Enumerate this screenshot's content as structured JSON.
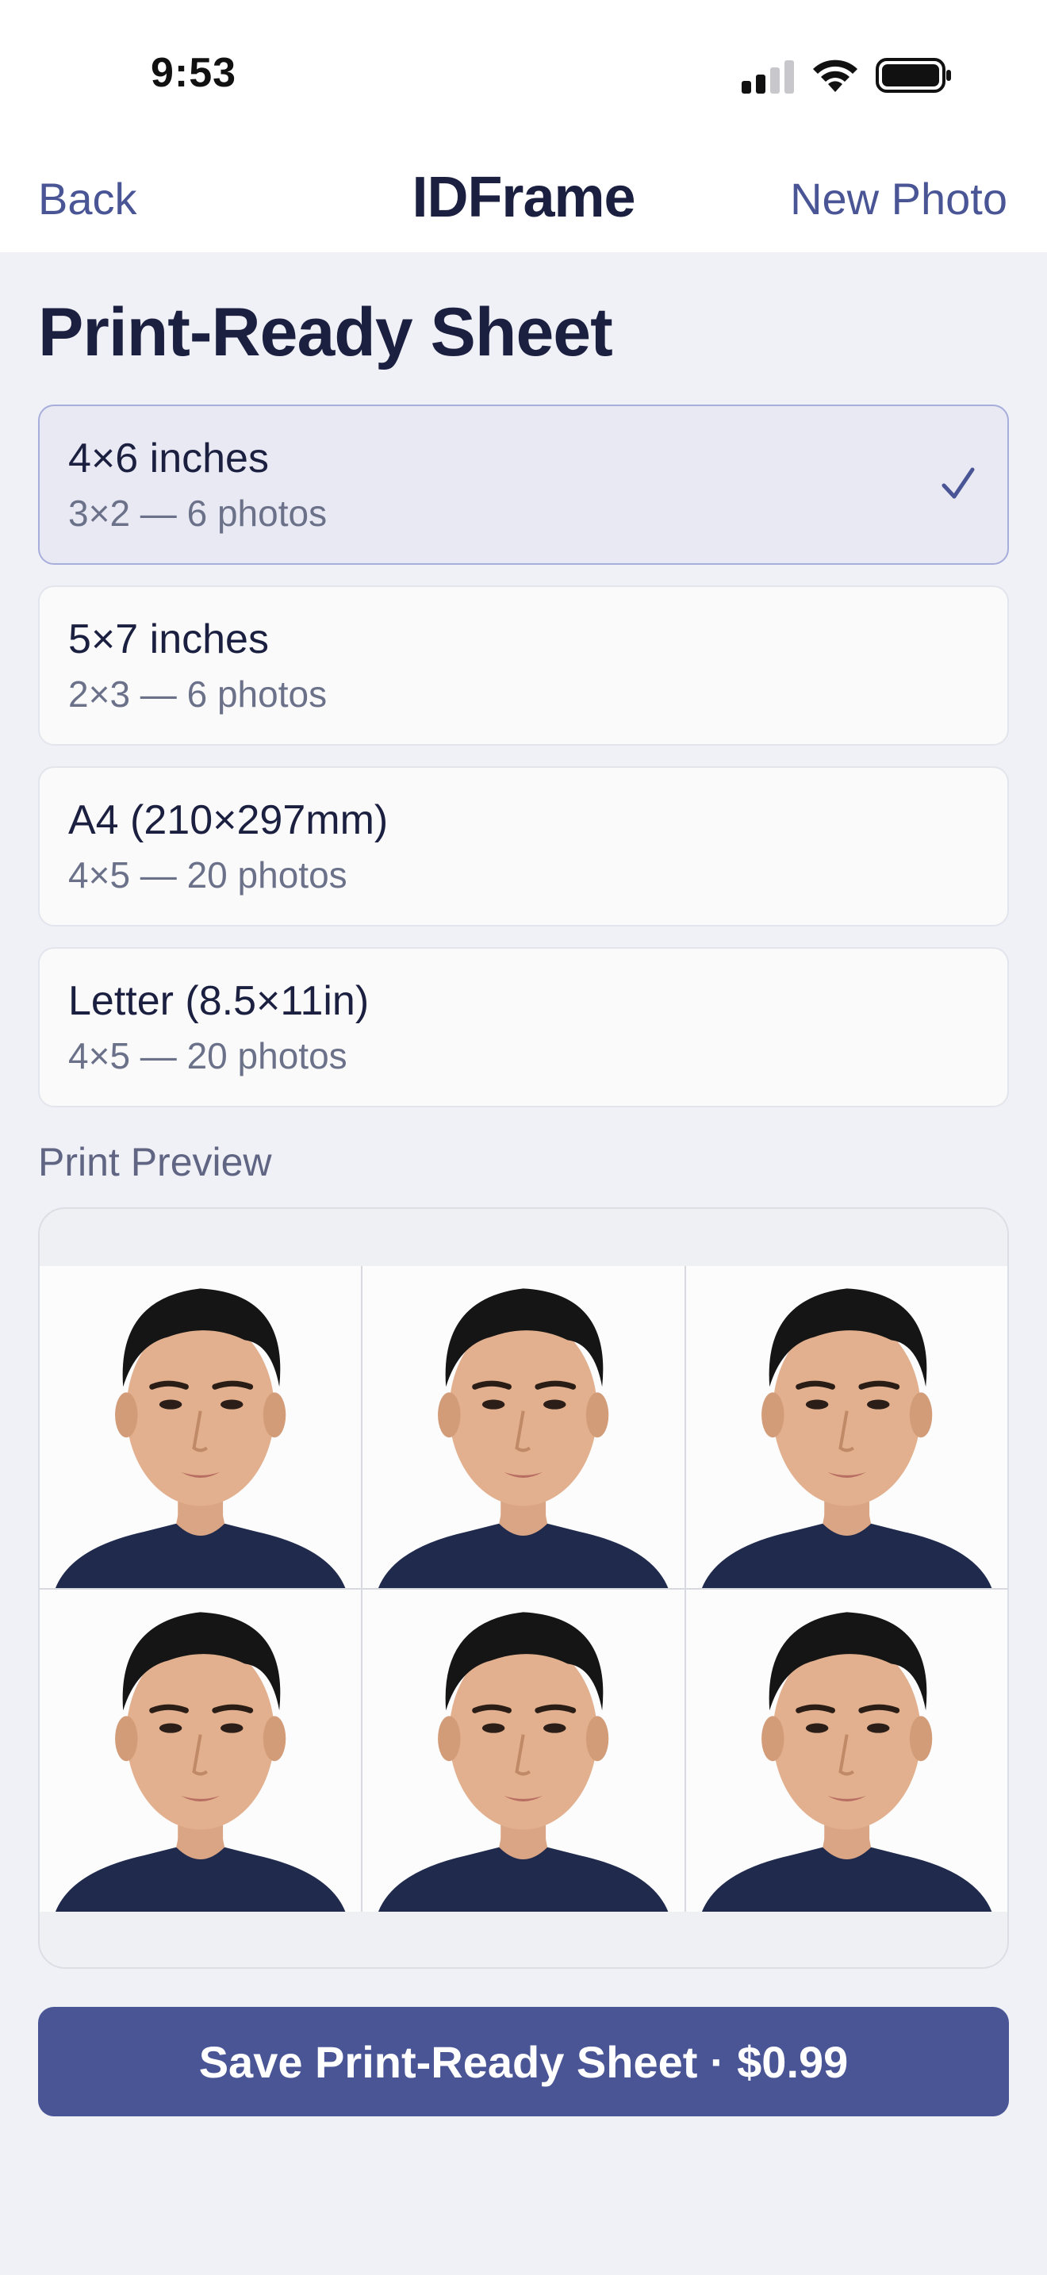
{
  "status_bar": {
    "time": "9:53"
  },
  "nav": {
    "back_label": "Back",
    "title": "IDFrame",
    "new_photo_label": "New Photo"
  },
  "page_title": "Print-Ready Sheet",
  "options": [
    {
      "label": "4×6 inches",
      "sub": "3×2 — 6 photos",
      "selected": true
    },
    {
      "label": "5×7 inches",
      "sub": "2×3 — 6 photos",
      "selected": false
    },
    {
      "label": "A4 (210×297mm)",
      "sub": "4×5 — 20 photos",
      "selected": false
    },
    {
      "label": "Letter (8.5×11in)",
      "sub": "4×5 — 20 photos",
      "selected": false
    }
  ],
  "preview_label": "Print Preview",
  "preview_photo_count": 6,
  "save_button_label": "Save Print-Ready Sheet · $0.99",
  "colors": {
    "accent": "#4a5596",
    "title": "#1c2040",
    "selected_bg": "#e8e9f3",
    "background": "#f0f1f6"
  },
  "icons": [
    "signal-icon",
    "wifi-icon",
    "battery-icon",
    "checkmark-icon"
  ]
}
